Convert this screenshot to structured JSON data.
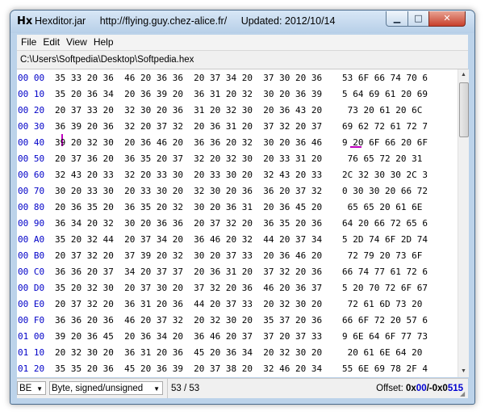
{
  "window": {
    "app_name": "Hexditor.jar",
    "url": "http://flying.guy.chez-alice.fr/",
    "updated": "Updated: 2012/10/14",
    "icon": "Hx"
  },
  "menu": [
    "File",
    "Edit",
    "View",
    "Help"
  ],
  "path": "C:\\Users\\Softpedia\\Desktop\\Softpedia.hex",
  "rows": [
    {
      "addr": "00 00",
      "hex": "35 33 20 36  46 20 36 36  20 37 34 20  37 30 20 36",
      "ascii": "53 6F 66 74 70 6"
    },
    {
      "addr": "00 10",
      "hex": "35 20 36 34  20 36 39 20  36 31 20 32  30 20 36 39",
      "ascii": "5 64 69 61 20 69"
    },
    {
      "addr": "00 20",
      "hex": "20 37 33 20  32 30 20 36  31 20 32 30  20 36 43 20",
      "ascii": " 73 20 61 20 6C"
    },
    {
      "addr": "00 30",
      "hex": "36 39 20 36  32 20 37 32  20 36 31 20  37 32 20 37",
      "ascii": "69 62 72 61 72 7"
    },
    {
      "addr": "00 40",
      "hex": "39 20 32 30  20 36 46 20  36 36 20 32  30 20 36 46",
      "ascii": "9 20 6F 66 20 6F"
    },
    {
      "addr": "00 50",
      "hex": "20 37 36 20  36 35 20 37  32 20 32 30  20 33 31 20",
      "ascii": " 76 65 72 20 31"
    },
    {
      "addr": "00 60",
      "hex": "32 43 20 33  32 20 33 30  20 33 30 20  32 43 20 33",
      "ascii": "2C 32 30 30 2C 3"
    },
    {
      "addr": "00 70",
      "hex": "30 20 33 30  20 33 30 20  32 30 20 36  36 20 37 32",
      "ascii": "0 30 30 20 66 72"
    },
    {
      "addr": "00 80",
      "hex": "20 36 35 20  36 35 20 32  30 20 36 31  20 36 45 20",
      "ascii": " 65 65 20 61 6E"
    },
    {
      "addr": "00 90",
      "hex": "36 34 20 32  30 20 36 36  20 37 32 20  36 35 20 36",
      "ascii": "64 20 66 72 65 6"
    },
    {
      "addr": "00 A0",
      "hex": "35 20 32 44  20 37 34 20  36 46 20 32  44 20 37 34",
      "ascii": "5 2D 74 6F 2D 74"
    },
    {
      "addr": "00 B0",
      "hex": "20 37 32 20  37 39 20 32  30 20 37 33  20 36 46 20",
      "ascii": " 72 79 20 73 6F"
    },
    {
      "addr": "00 C0",
      "hex": "36 36 20 37  34 20 37 37  20 36 31 20  37 32 20 36",
      "ascii": "66 74 77 61 72 6"
    },
    {
      "addr": "00 D0",
      "hex": "35 20 32 30  20 37 30 20  37 32 20 36  46 20 36 37",
      "ascii": "5 20 70 72 6F 67"
    },
    {
      "addr": "00 E0",
      "hex": "20 37 32 20  36 31 20 36  44 20 37 33  20 32 30 20",
      "ascii": " 72 61 6D 73 20"
    },
    {
      "addr": "00 F0",
      "hex": "36 36 20 36  46 20 37 32  20 32 30 20  35 37 20 36",
      "ascii": "66 6F 72 20 57 6"
    },
    {
      "addr": "01 00",
      "hex": "39 20 36 45  20 36 34 20  36 46 20 37  37 20 37 33",
      "ascii": "9 6E 64 6F 77 73"
    },
    {
      "addr": "01 10",
      "hex": "20 32 30 20  36 31 20 36  45 20 36 34  20 32 30 20",
      "ascii": " 20 61 6E 64 20"
    },
    {
      "addr": "01 20",
      "hex": "35 35 20 36  45 20 36 39  20 37 38 20  32 46 20 34",
      "ascii": "55 6E 69 78 2F 4"
    }
  ],
  "status": {
    "endian": "BE",
    "data_type": "Byte, signed/unsigned",
    "count": "53 / 53",
    "offset_label": "Offset:",
    "offset_a_prefix": "0x",
    "offset_a_value": "00",
    "offset_sep": "/-",
    "offset_b_prefix": "0x0",
    "offset_b_value": "515"
  },
  "colors": {
    "address": "#0000c8",
    "caret": "#c000c0",
    "offset_highlight": "#0000d0"
  }
}
